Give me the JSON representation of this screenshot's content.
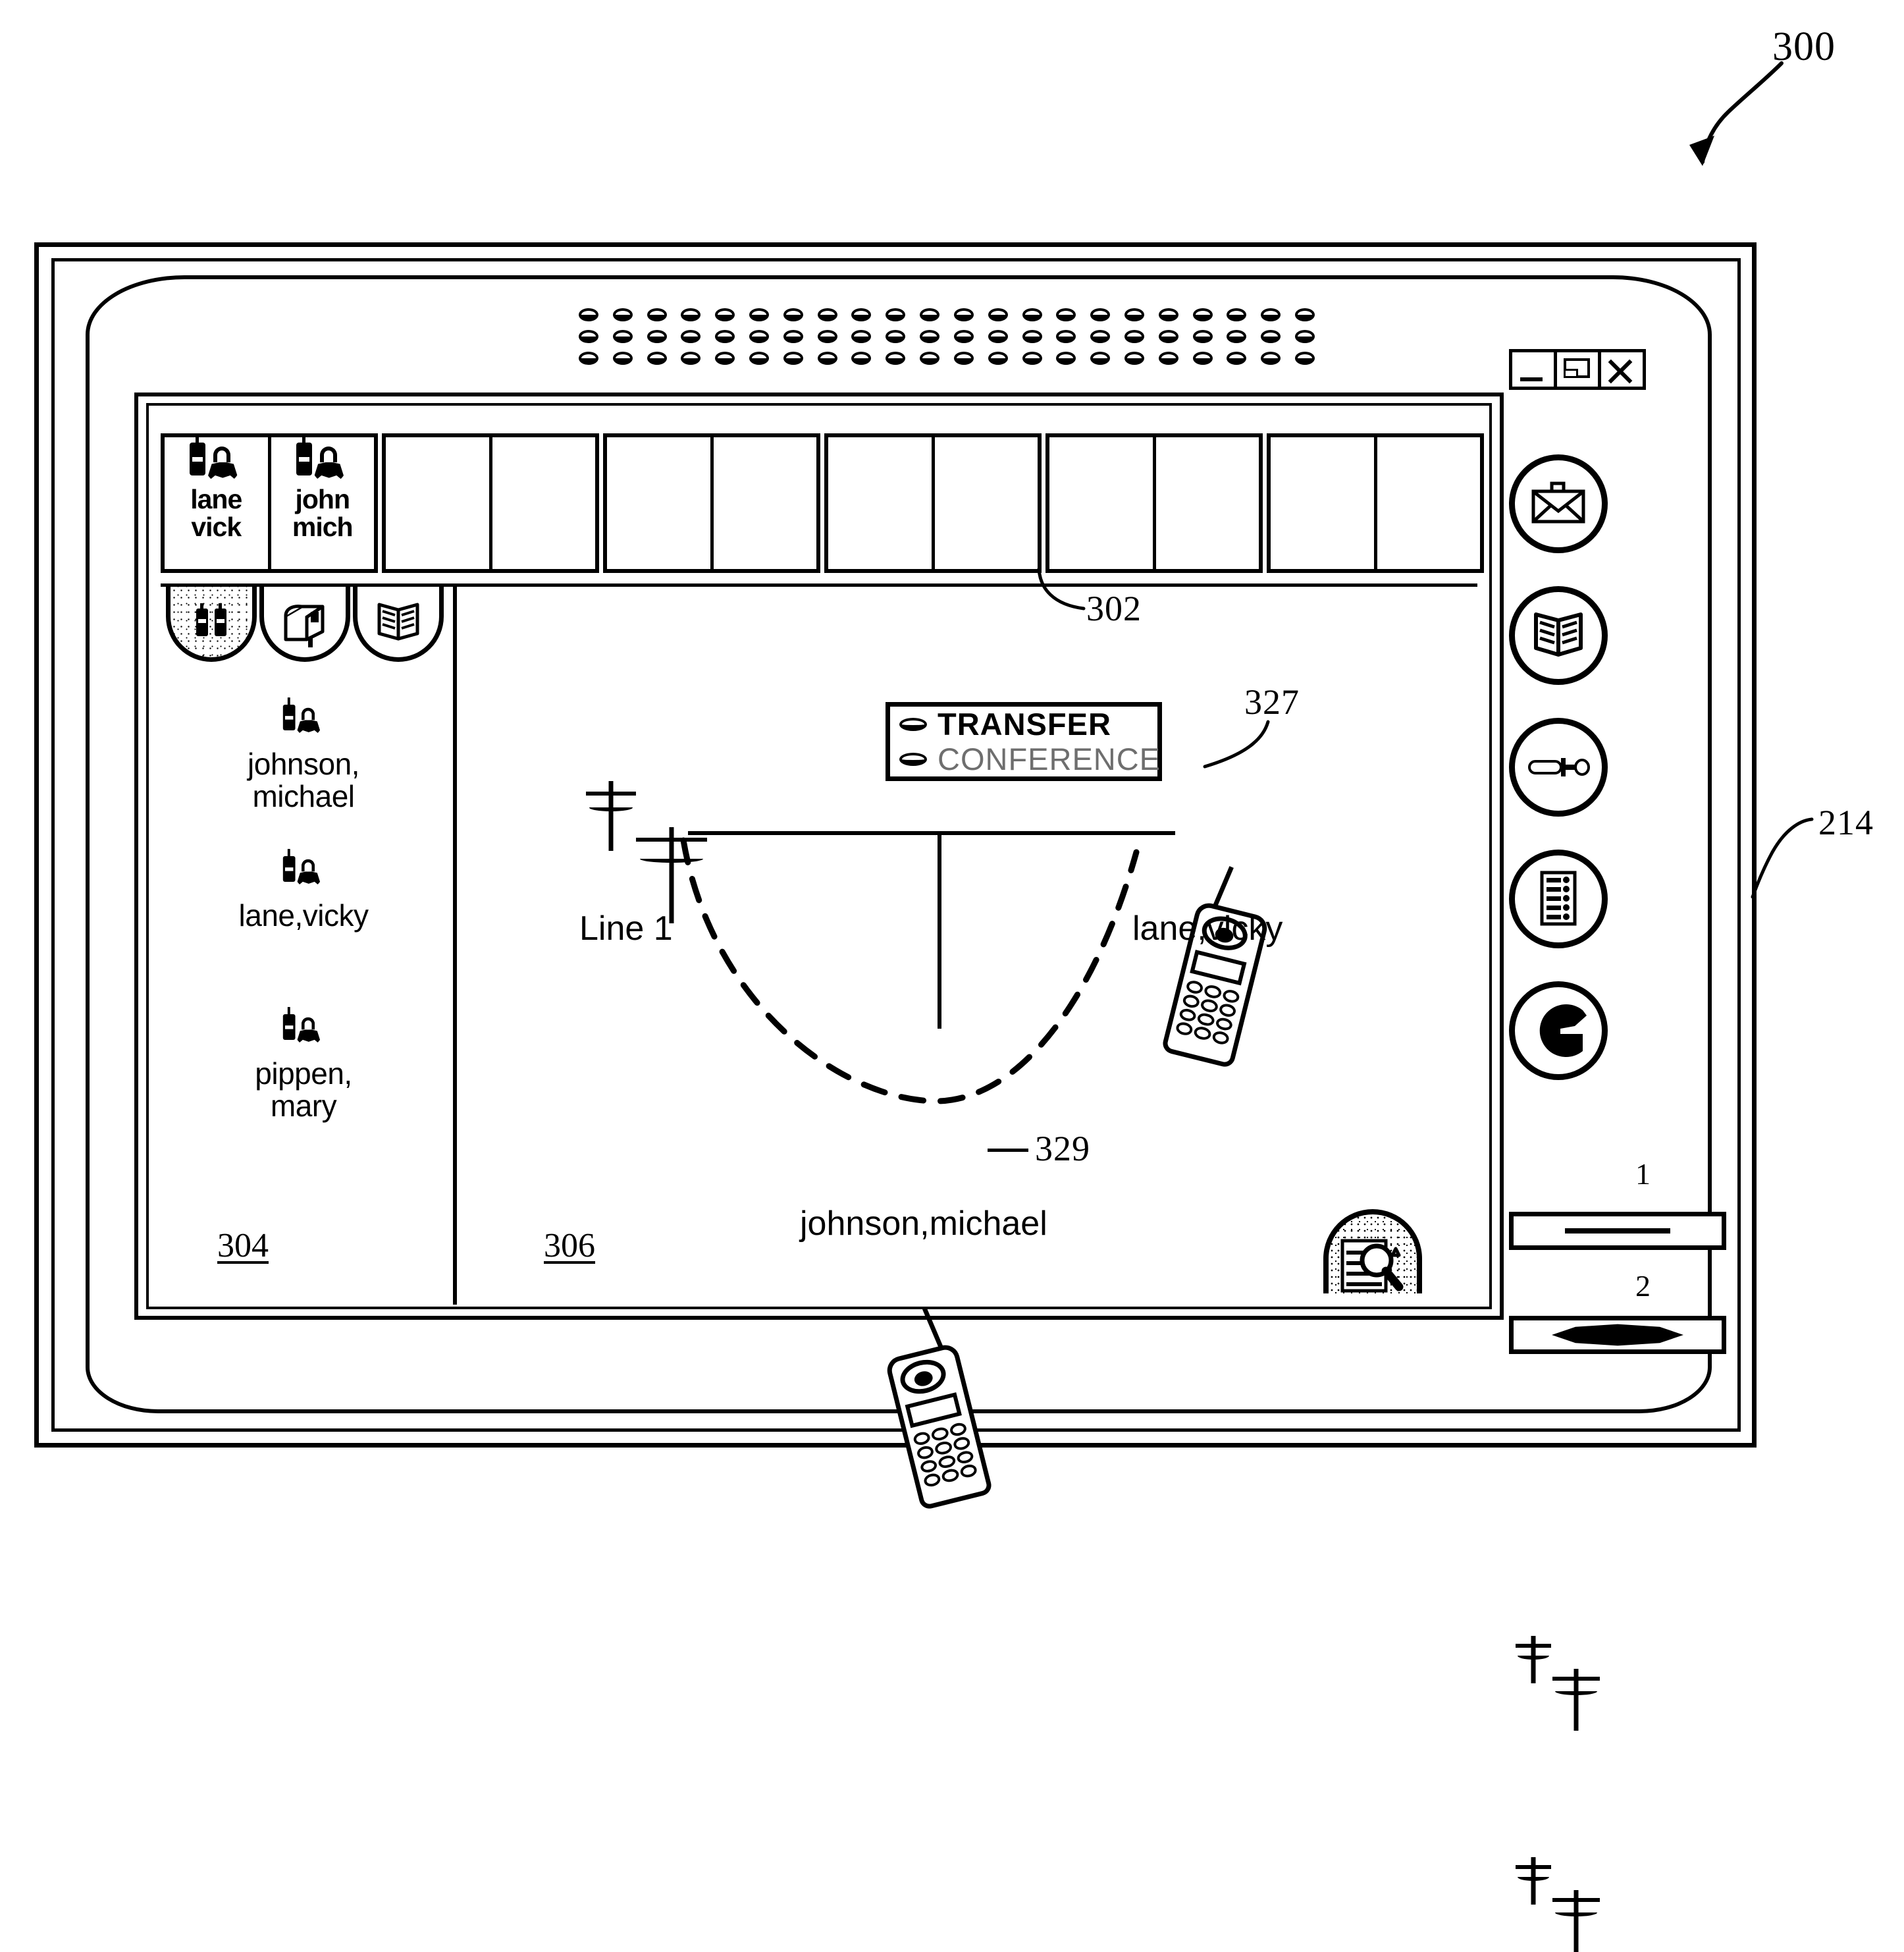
{
  "figure": {
    "number": "300",
    "device_ref": "214",
    "tabstrip_ref": "302",
    "left_panel_ref": "304",
    "main_panel_ref": "306",
    "phone_remote_ref": "327",
    "phone_local_ref": "329"
  },
  "window_controls": [
    {
      "name": "minimize",
      "glyph": "minimize-icon"
    },
    {
      "name": "restore",
      "glyph": "restore-icon"
    },
    {
      "name": "close",
      "glyph": "close-icon"
    }
  ],
  "tabstrip": {
    "groups": [
      {
        "cells": [
          {
            "label_line1": "lane",
            "label_line2": "vick",
            "has_icon": true
          },
          {
            "label_line1": "john",
            "label_line2": "mich",
            "has_icon": true
          }
        ]
      },
      {
        "cells": [
          {
            "label_line1": "",
            "label_line2": "",
            "has_icon": false
          },
          {
            "label_line1": "",
            "label_line2": "",
            "has_icon": false
          }
        ]
      },
      {
        "cells": [
          {
            "label_line1": "",
            "label_line2": "",
            "has_icon": false
          },
          {
            "label_line1": "",
            "label_line2": "",
            "has_icon": false
          }
        ]
      },
      {
        "cells": [
          {
            "label_line1": "",
            "label_line2": "",
            "has_icon": false
          },
          {
            "label_line1": "",
            "label_line2": "",
            "has_icon": false
          }
        ]
      },
      {
        "cells": [
          {
            "label_line1": "",
            "label_line2": "",
            "has_icon": false
          },
          {
            "label_line1": "",
            "label_line2": "",
            "has_icon": false
          }
        ]
      },
      {
        "cells": [
          {
            "label_line1": "",
            "label_line2": "",
            "has_icon": false
          },
          {
            "label_line1": "",
            "label_line2": "",
            "has_icon": false
          }
        ]
      }
    ]
  },
  "left_panel": {
    "dome_buttons": [
      {
        "icon": "two-handsets-icon",
        "selected": true
      },
      {
        "icon": "mailbox-icon",
        "selected": false
      },
      {
        "icon": "open-book-icon",
        "selected": false
      }
    ],
    "contacts": [
      {
        "line1": "johnson,",
        "line2": "michael",
        "icon": "person-handset-icon"
      },
      {
        "line1": "lane,vicky",
        "line2": "",
        "icon": "person-handset-icon"
      },
      {
        "line1": "pippen,",
        "line2": "mary",
        "icon": "person-handset-icon"
      }
    ]
  },
  "main_panel": {
    "menu": {
      "options": [
        {
          "label": "TRANSFER",
          "state": "active"
        },
        {
          "label": "CONFERENCE",
          "state": "dimmed"
        }
      ]
    },
    "line_label": "Line  1",
    "remote_party_label": "lane,vicky",
    "local_party_label": "johnson,michael",
    "search_button_icon": "document-magnifier-icon"
  },
  "toolbar": {
    "buttons": [
      {
        "icon": "envelope-icon",
        "name": "messages"
      },
      {
        "icon": "open-book-icon",
        "name": "directory"
      },
      {
        "icon": "screwdriver-icon",
        "name": "settings"
      },
      {
        "icon": "keypad-list-icon",
        "name": "call-log"
      },
      {
        "icon": "c-logo-icon",
        "name": "brand"
      }
    ],
    "lines": [
      {
        "number": "1",
        "indicator": "thin-line",
        "icon": "two-poles-icon"
      },
      {
        "number": "2",
        "indicator": "filled-lens",
        "icon": "two-poles-icon"
      }
    ]
  }
}
